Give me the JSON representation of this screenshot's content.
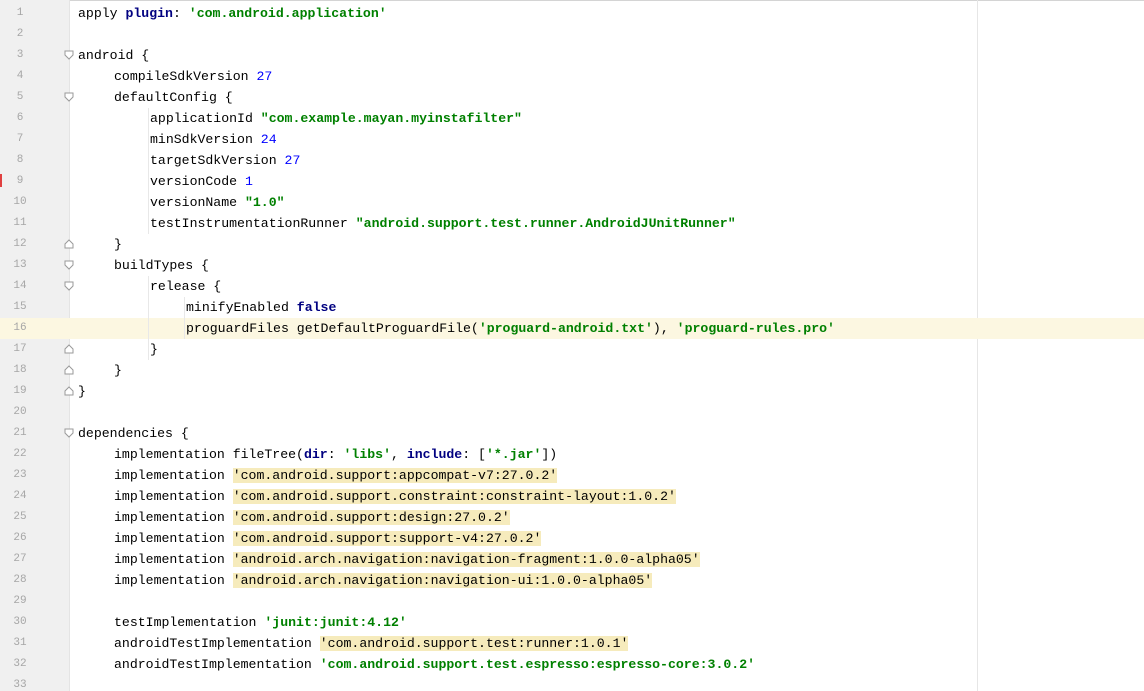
{
  "editor": {
    "highlighted_line": 16,
    "lines": [
      {
        "n": "1",
        "indent": 0,
        "fold": "",
        "parts": [
          [
            "apply ",
            "p"
          ],
          [
            "plugin",
            "kw"
          ],
          [
            ": ",
            "p"
          ],
          [
            "'com.android.application'",
            "str"
          ]
        ]
      },
      {
        "n": "2",
        "indent": 0,
        "fold": "",
        "parts": []
      },
      {
        "n": "3",
        "indent": 0,
        "fold": "open",
        "parts": [
          [
            "android {",
            "p"
          ]
        ]
      },
      {
        "n": "4",
        "indent": 1,
        "fold": "",
        "parts": [
          [
            "compileSdkVersion ",
            "p"
          ],
          [
            "27",
            "num"
          ]
        ]
      },
      {
        "n": "5",
        "indent": 1,
        "fold": "open",
        "parts": [
          [
            "defaultConfig {",
            "p"
          ]
        ]
      },
      {
        "n": "6",
        "indent": 2,
        "fold": "",
        "parts": [
          [
            "applicationId ",
            "p"
          ],
          [
            "\"com.example.mayan.myinstafilter\"",
            "str"
          ]
        ]
      },
      {
        "n": "7",
        "indent": 2,
        "fold": "",
        "parts": [
          [
            "minSdkVersion ",
            "p"
          ],
          [
            "24",
            "num"
          ]
        ]
      },
      {
        "n": "8",
        "indent": 2,
        "fold": "",
        "parts": [
          [
            "targetSdkVersion ",
            "p"
          ],
          [
            "27",
            "num"
          ]
        ]
      },
      {
        "n": "9",
        "indent": 2,
        "fold": "",
        "parts": [
          [
            "versionCode ",
            "p"
          ],
          [
            "1",
            "num"
          ]
        ]
      },
      {
        "n": "10",
        "indent": 2,
        "fold": "",
        "parts": [
          [
            "versionName ",
            "p"
          ],
          [
            "\"1.0\"",
            "str"
          ]
        ]
      },
      {
        "n": "11",
        "indent": 2,
        "fold": "",
        "parts": [
          [
            "testInstrumentationRunner ",
            "p"
          ],
          [
            "\"android.support.test.runner.AndroidJUnitRunner\"",
            "str"
          ]
        ]
      },
      {
        "n": "12",
        "indent": 1,
        "fold": "close",
        "parts": [
          [
            "}",
            "p"
          ]
        ]
      },
      {
        "n": "13",
        "indent": 1,
        "fold": "open",
        "parts": [
          [
            "buildTypes {",
            "p"
          ]
        ]
      },
      {
        "n": "14",
        "indent": 2,
        "fold": "open",
        "parts": [
          [
            "release {",
            "p"
          ]
        ]
      },
      {
        "n": "15",
        "indent": 3,
        "fold": "",
        "parts": [
          [
            "minifyEnabled ",
            "p"
          ],
          [
            "false",
            "kw"
          ]
        ]
      },
      {
        "n": "16",
        "indent": 3,
        "fold": "",
        "parts": [
          [
            "proguardFiles getDefaultProguardFile(",
            "p"
          ],
          [
            "'proguard-android.txt'",
            "str"
          ],
          [
            "), ",
            "p"
          ],
          [
            "'proguard-rules.pro'",
            "str"
          ]
        ]
      },
      {
        "n": "17",
        "indent": 2,
        "fold": "close",
        "parts": [
          [
            "}",
            "p"
          ]
        ]
      },
      {
        "n": "18",
        "indent": 1,
        "fold": "close",
        "parts": [
          [
            "}",
            "p"
          ]
        ]
      },
      {
        "n": "19",
        "indent": 0,
        "fold": "close",
        "parts": [
          [
            "}",
            "p"
          ]
        ]
      },
      {
        "n": "20",
        "indent": 0,
        "fold": "",
        "parts": []
      },
      {
        "n": "21",
        "indent": 0,
        "fold": "open",
        "parts": [
          [
            "dependencies {",
            "p"
          ]
        ]
      },
      {
        "n": "22",
        "indent": 1,
        "fold": "",
        "parts": [
          [
            "implementation fileTree(",
            "p"
          ],
          [
            "dir",
            "kw"
          ],
          [
            ": ",
            "p"
          ],
          [
            "'libs'",
            "str"
          ],
          [
            ", ",
            "p"
          ],
          [
            "include",
            "kw"
          ],
          [
            ": [",
            "p"
          ],
          [
            "'*.jar'",
            "str"
          ],
          [
            "])",
            "p"
          ]
        ]
      },
      {
        "n": "23",
        "indent": 1,
        "fold": "",
        "parts": [
          [
            "implementation ",
            "p"
          ],
          [
            "'com.android.support:appcompat-v7:27.0.2'",
            "hl"
          ]
        ]
      },
      {
        "n": "24",
        "indent": 1,
        "fold": "",
        "parts": [
          [
            "implementation ",
            "p"
          ],
          [
            "'com.android.support.constraint:constraint-layout:1.0.2'",
            "hl"
          ]
        ]
      },
      {
        "n": "25",
        "indent": 1,
        "fold": "",
        "parts": [
          [
            "implementation ",
            "p"
          ],
          [
            "'com.android.support:design:27.0.2'",
            "hl"
          ]
        ]
      },
      {
        "n": "26",
        "indent": 1,
        "fold": "",
        "parts": [
          [
            "implementation ",
            "p"
          ],
          [
            "'com.android.support:support-v4:27.0.2'",
            "hl"
          ]
        ]
      },
      {
        "n": "27",
        "indent": 1,
        "fold": "",
        "parts": [
          [
            "implementation ",
            "p"
          ],
          [
            "'android.arch.navigation:navigation-fragment:1.0.0-alpha05'",
            "hl"
          ]
        ]
      },
      {
        "n": "28",
        "indent": 1,
        "fold": "",
        "parts": [
          [
            "implementation ",
            "p"
          ],
          [
            "'android.arch.navigation:navigation-ui:1.0.0-alpha05'",
            "hl"
          ]
        ]
      },
      {
        "n": "29",
        "indent": 0,
        "fold": "",
        "parts": []
      },
      {
        "n": "30",
        "indent": 1,
        "fold": "",
        "parts": [
          [
            "testImplementation ",
            "p"
          ],
          [
            "'junit:junit:4.12'",
            "str"
          ]
        ]
      },
      {
        "n": "31",
        "indent": 1,
        "fold": "",
        "parts": [
          [
            "androidTestImplementation ",
            "p"
          ],
          [
            "'com.android.support.test:runner:1.0.1'",
            "hl"
          ]
        ]
      },
      {
        "n": "32",
        "indent": 1,
        "fold": "",
        "parts": [
          [
            "androidTestImplementation ",
            "p"
          ],
          [
            "'com.android.support.test.espresso:espresso-core:3.0.2'",
            "str"
          ]
        ]
      },
      {
        "n": "33",
        "indent": 0,
        "fold": "",
        "parts": []
      }
    ]
  },
  "colors": {
    "keyword": "#000080",
    "string": "#008000",
    "number": "#0000ff",
    "dependency_highlight": "#f6ebbc",
    "caret_row": "#fcf7e1",
    "gutter": "#f0f0f0"
  },
  "icons": {
    "fold_open": "fold-open-icon",
    "fold_close": "fold-close-icon"
  }
}
